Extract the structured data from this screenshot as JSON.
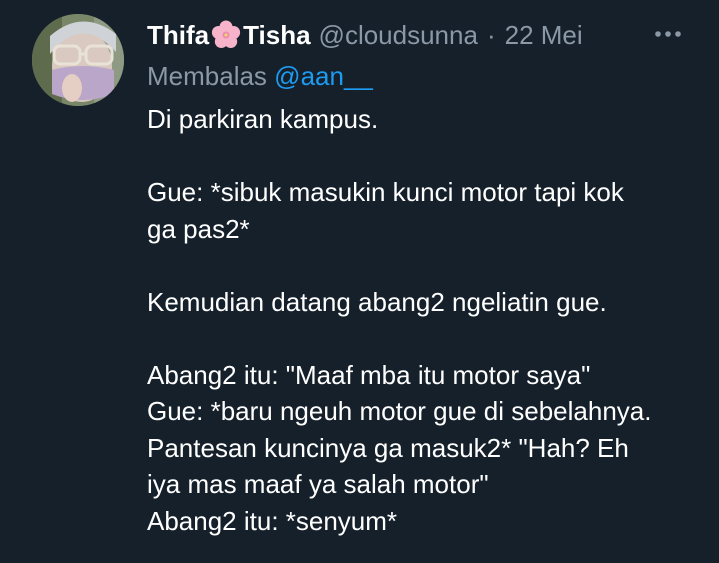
{
  "author": {
    "name_part1": "Thifa",
    "name_part2": "Tisha",
    "name_emoji": "cherry-blossom-icon",
    "handle": "@cloudsunna",
    "separator": "·",
    "date": "22 Mei"
  },
  "reply": {
    "prefix": "Membalas",
    "mention": "@aan__"
  },
  "tweet_lines": [
    "Di parkiran kampus.",
    "",
    "Gue: *sibuk masukin kunci motor tapi kok",
    "ga pas2*",
    "",
    "Kemudian datang abang2 ngeliatin gue.",
    "",
    "Abang2 itu: \"Maaf mba itu motor saya\"",
    "Gue: *baru ngeuh motor gue di sebelahnya.",
    "Pantesan kuncinya ga masuk2* \"Hah? Eh",
    "iya mas maaf ya salah motor\"",
    "Abang2 itu: *senyum*"
  ],
  "icons": {
    "more": "more-options-icon",
    "avatar": "avatar"
  },
  "colors": {
    "background": "#15202b",
    "text_primary": "#ffffff",
    "text_secondary": "#8b98a5",
    "link": "#1d9bf0"
  }
}
